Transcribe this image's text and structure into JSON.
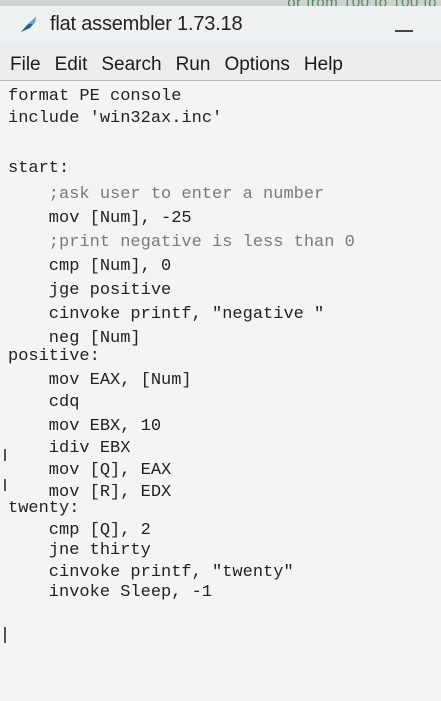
{
  "background_text": "or from 100 to 100 to",
  "window": {
    "title": "flat assembler 1.73.18",
    "icon": "feather-app-icon",
    "minimize_icon": "minimize-icon"
  },
  "menu": [
    "File",
    "Edit",
    "Search",
    "Run",
    "Options",
    "Help"
  ],
  "code": {
    "lines": [
      "format PE console",
      "include 'win32ax.inc'",
      "",
      "start:",
      "    ;ask user to enter a number",
      "    mov [Num], -25",
      "    ;print negative is less than 0",
      "    cmp [Num], 0",
      "    jge positive",
      "    cinvoke printf, \"negative \"",
      "    neg [Num]",
      "positive:",
      "    mov EAX, [Num]",
      "    cdq",
      "    mov EBX, 10",
      "    idiv EBX",
      "    mov [Q], EAX",
      "    mov [R], EDX",
      "twenty:",
      "    cmp [Q], 2",
      "    jne thirty",
      "    cinvoke printf, \"twenty\"",
      "    invoke Sleep, -1"
    ]
  },
  "colors": {
    "editor_bg": "#f4f4f4",
    "menu_bg": "#ededed",
    "title_bg": "#eef1f2",
    "background_text": "#4f8a5c"
  }
}
